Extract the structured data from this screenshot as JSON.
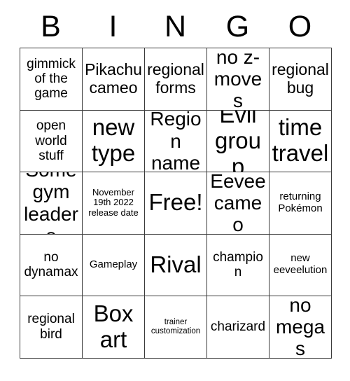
{
  "card": {
    "header_letters": [
      "B",
      "I",
      "N",
      "G",
      "O"
    ],
    "rows": [
      [
        {
          "text": "gimmick of the game",
          "size": "md"
        },
        {
          "text": "Pikachu cameo",
          "size": "lg"
        },
        {
          "text": "regional forms",
          "size": "lg"
        },
        {
          "text": "no z-moves",
          "size": "xl"
        },
        {
          "text": "regional bug",
          "size": "lg"
        }
      ],
      [
        {
          "text": "open world stuff",
          "size": "md"
        },
        {
          "text": "new type",
          "size": "xxl"
        },
        {
          "text": "Region name",
          "size": "xl"
        },
        {
          "text": "Evil group",
          "size": "xxl"
        },
        {
          "text": "time travel",
          "size": "xxl"
        }
      ],
      [
        {
          "text": "Some gym leaders",
          "size": "xl"
        },
        {
          "text": "November 19th 2022 release date",
          "size": "xs"
        },
        {
          "text": "Free!",
          "size": "xxl"
        },
        {
          "text": "Eevee cameo",
          "size": "xl"
        },
        {
          "text": "returning Pokémon",
          "size": "sm"
        }
      ],
      [
        {
          "text": "no dynamax",
          "size": "md"
        },
        {
          "text": "Gameplay",
          "size": "sm"
        },
        {
          "text": "Rival",
          "size": "xxl"
        },
        {
          "text": "champion",
          "size": "md"
        },
        {
          "text": "new eeveelution",
          "size": "sm"
        }
      ],
      [
        {
          "text": "regional bird",
          "size": "md"
        },
        {
          "text": "Box art",
          "size": "xxl"
        },
        {
          "text": "trainer customization",
          "size": "xxs"
        },
        {
          "text": "charizard",
          "size": "md"
        },
        {
          "text": "no megas",
          "size": "xl"
        }
      ]
    ]
  }
}
